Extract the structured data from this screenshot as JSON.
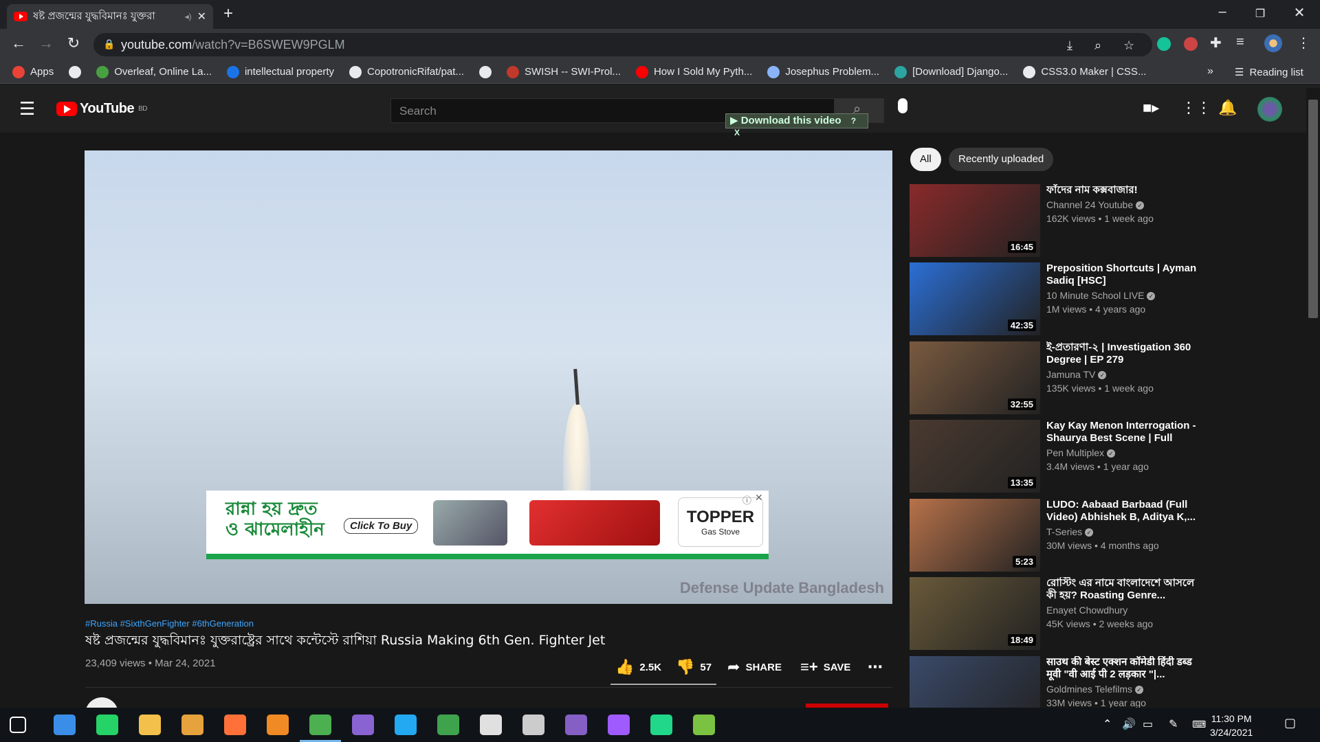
{
  "browser": {
    "tab_title": "ষষ্ট প্রজন্মের যুদ্ধবিমানঃ যুক্তরা",
    "url_host": "youtube.com",
    "url_path": "/watch?v=B6SWEW9PGLM",
    "bookmarks": [
      {
        "label": "Apps",
        "icon": "apps-grid-icon",
        "color": "#ea4335"
      },
      {
        "label": "",
        "icon": "globe-icon",
        "color": "#e8eaed"
      },
      {
        "label": "Overleaf, Online La...",
        "icon": "overleaf-icon",
        "color": "#47a141"
      },
      {
        "label": "intellectual property",
        "icon": "s-icon",
        "color": "#1a73e8"
      },
      {
        "label": "CopotronicRifat/pat...",
        "icon": "github-icon",
        "color": "#e8eaed"
      },
      {
        "label": "",
        "icon": "globe-icon",
        "color": "#e8eaed"
      },
      {
        "label": "SWISH -- SWI-Prol...",
        "icon": "swish-icon",
        "color": "#c0392b"
      },
      {
        "label": "How I Sold My Pyth...",
        "icon": "youtube-icon",
        "color": "#ff0000"
      },
      {
        "label": "Josephus Problem...",
        "icon": "loading-icon",
        "color": "#8ab4f8"
      },
      {
        "label": "[Download] Django...",
        "icon": "django-icon",
        "color": "#2ba4a2"
      },
      {
        "label": "CSS3.0 Maker | CSS...",
        "icon": "globe-icon",
        "color": "#e8eaed"
      }
    ],
    "reading_list": "Reading list",
    "more_bookmarks": "»"
  },
  "youtube": {
    "logo_text": "YouTube",
    "logo_region": "BD",
    "search_placeholder": "Search",
    "download_bar": "Download this video",
    "download_bar_help": "?",
    "download_bar_close": "X"
  },
  "video": {
    "hashtags": "#Russia #SixthGenFighter #6thGeneration",
    "title": "ষষ্ট প্রজন্মের যুদ্ধবিমানঃ যুক্তরাষ্ট্রের সাথে কন্টেস্টে রাশিয়া Russia Making 6th Gen. Fighter Jet",
    "views": "23,409 views",
    "date": "Mar 24, 2021",
    "likes": "2.5K",
    "dislikes": "57",
    "share": "SHARE",
    "save": "SAVE",
    "watermark": "Defense Update Bangladesh",
    "ad": {
      "headline": "রান্না হয় দ্রুত ও ঝামেলাহীন",
      "cta": "Click To Buy",
      "brand": "TOPPER",
      "brand_sub": "Gas Stove"
    }
  },
  "sidebar": {
    "chips": [
      "All",
      "Recently uploaded"
    ],
    "recommendations": [
      {
        "title": "ফাঁদের নাম কক্সবাজার!",
        "channel": "Channel 24 Youtube",
        "verified": true,
        "meta": "162K views • 1 week ago",
        "duration": "16:45",
        "thumb_color": "#8a2a2a"
      },
      {
        "title": "Preposition Shortcuts | Ayman Sadiq [HSC]",
        "channel": "10 Minute School LIVE",
        "verified": true,
        "meta": "1M views • 4 years ago",
        "duration": "42:35",
        "thumb_color": "#2b6fd6"
      },
      {
        "title": "ই-প্রতারণা-২ | Investigation 360 Degree | EP 279",
        "channel": "Jamuna TV",
        "verified": true,
        "meta": "135K views • 1 week ago",
        "duration": "32:55",
        "thumb_color": "#7a5a40"
      },
      {
        "title": "Kay Kay Menon Interrogation - Shaurya Best Scene | Full Hind...",
        "channel": "Pen Multiplex",
        "verified": true,
        "meta": "3.4M views • 1 year ago",
        "duration": "13:35",
        "thumb_color": "#4a3a30"
      },
      {
        "title": "LUDO: Aabaad Barbaad (Full Video) Abhishek B, Aditya K,...",
        "channel": "T-Series",
        "verified": true,
        "meta": "30M views • 4 months ago",
        "duration": "5:23",
        "thumb_color": "#b8724a"
      },
      {
        "title": "রোস্টিং এর নামে বাংলাদেশে আসলে কী হয়? Roasting Genre...",
        "channel": "Enayet Chowdhury",
        "verified": false,
        "meta": "45K views • 2 weeks ago",
        "duration": "18:49",
        "thumb_color": "#6a5a3a"
      },
      {
        "title": "साउथ की बेस्ट एक्शन कॉमेडी हिंदी डब्ड मूवी \"वी आई पी 2 लड़कार \"|...",
        "channel": "Goldmines Telefilms",
        "verified": true,
        "meta": "33M views • 1 year ago",
        "duration": "",
        "thumb_color": "#3a4a6a"
      }
    ]
  },
  "taskbar": {
    "time": "11:30 PM",
    "date": "3/24/2021",
    "apps": [
      {
        "icon": "windows-start-icon",
        "color": "#ffffff"
      },
      {
        "icon": "refresh-app-icon",
        "color": "#3b8ee8"
      },
      {
        "icon": "whatsapp-icon",
        "color": "#25d366"
      },
      {
        "icon": "file-explorer-icon",
        "color": "#f3c14b"
      },
      {
        "icon": "shield-app-icon",
        "color": "#e6a23c"
      },
      {
        "icon": "firefox-icon",
        "color": "#ff7139"
      },
      {
        "icon": "photo-app-icon",
        "color": "#f08a24"
      },
      {
        "icon": "chrome-icon",
        "color": "#4caf50"
      },
      {
        "icon": "github-desktop-icon",
        "color": "#8a63d2"
      },
      {
        "icon": "vscode-icon",
        "color": "#23a9f2"
      },
      {
        "icon": "earth-app-icon",
        "color": "#3fa34d"
      },
      {
        "icon": "paint-app-icon",
        "color": "#e0e0e0"
      },
      {
        "icon": "inkscape-icon",
        "color": "#cccccc"
      },
      {
        "icon": "visual-studio-icon",
        "color": "#865fc5"
      },
      {
        "icon": "messenger-icon",
        "color": "#a05bff"
      },
      {
        "icon": "pycharm-icon",
        "color": "#21d789"
      },
      {
        "icon": "notepad-app-icon",
        "color": "#7cc242"
      }
    ]
  }
}
